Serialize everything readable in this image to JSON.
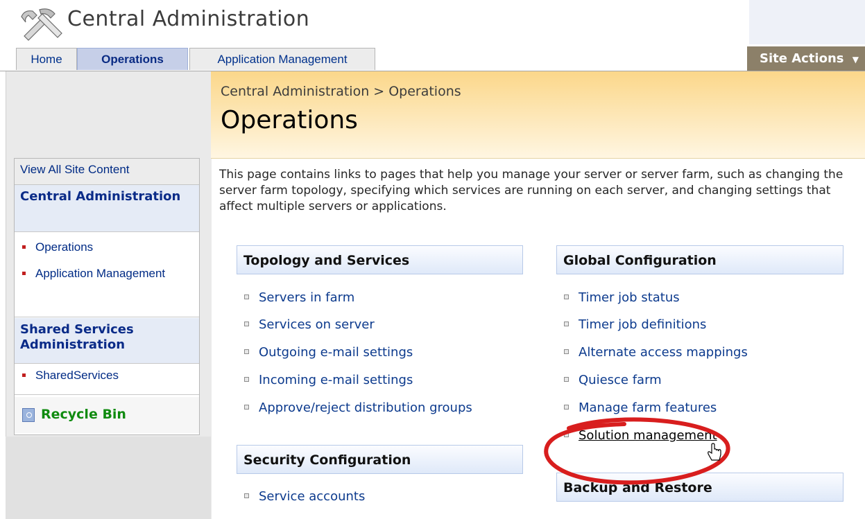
{
  "site": {
    "title": "Central Administration"
  },
  "tabs": [
    {
      "label": "Home",
      "selected": false
    },
    {
      "label": "Operations",
      "selected": true
    },
    {
      "label": "Application Management",
      "selected": false
    }
  ],
  "site_actions": {
    "label": "Site Actions",
    "icon": "chevron-down-icon"
  },
  "breadcrumb": {
    "root": "Central Administration",
    "separator": ">",
    "current": "Operations"
  },
  "page": {
    "title": "Operations",
    "intro": "This page contains links to pages that help you manage your server or server farm, such as changing the server farm topology, specifying which services are running on each server, and changing settings that affect multiple servers or applications."
  },
  "quick_launch": {
    "view_all": "View All Site Content",
    "central_header": "Central Administration",
    "central_items": [
      "Operations",
      "Application Management"
    ],
    "shared_header": "Shared Services Administration",
    "shared_items": [
      "SharedServices"
    ],
    "recycle_bin": "Recycle Bin"
  },
  "sections": {
    "topology": {
      "title": "Topology and Services",
      "links": [
        "Servers in farm",
        "Services on server",
        "Outgoing e-mail settings",
        "Incoming e-mail settings",
        "Approve/reject distribution groups"
      ]
    },
    "global": {
      "title": "Global Configuration",
      "links": [
        "Timer job status",
        "Timer job definitions",
        "Alternate access mappings",
        "Quiesce farm",
        "Manage farm features",
        "Solution management"
      ]
    },
    "security": {
      "title": "Security Configuration",
      "links": [
        "Service accounts"
      ]
    },
    "backup": {
      "title": "Backup and Restore"
    }
  },
  "colors": {
    "link": "#0c3a8d",
    "header_gradient_top": "#fbd78a",
    "site_actions_bg": "#8c8069",
    "annotation_circle": "#d81e1e",
    "recycle_bin_text": "#108b10"
  }
}
